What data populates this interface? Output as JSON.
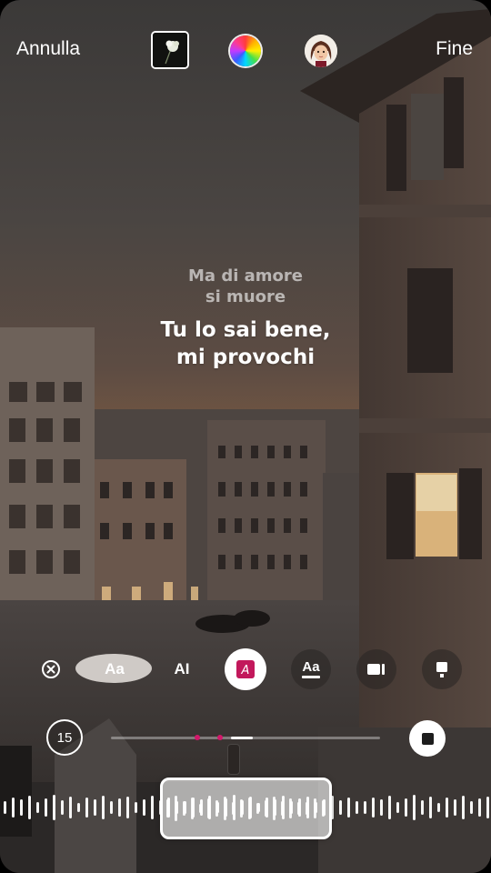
{
  "header": {
    "cancel_label": "Annulla",
    "done_label": "Fine"
  },
  "lyrics": {
    "previous_lines": [
      "Ma di amore",
      "si muore"
    ],
    "current_lines": [
      "Tu lo sai bene,",
      "mi provochi"
    ]
  },
  "toolbar": {
    "tools": [
      {
        "name": "close",
        "glyph": "⊗"
      },
      {
        "name": "font-size",
        "glyph": "Aa"
      },
      {
        "name": "text-animation",
        "glyph": "AI"
      },
      {
        "name": "highlight",
        "glyph": "A",
        "selected": true
      },
      {
        "name": "text-style",
        "glyph": "Aa"
      },
      {
        "name": "video",
        "glyph": ""
      },
      {
        "name": "card",
        "glyph": ""
      }
    ]
  },
  "player": {
    "duration_label": "15",
    "progress": 0.5
  },
  "colors": {
    "accent_highlight": "#c2185b",
    "progress_marker": "#d2186a",
    "text": "#ffffff"
  }
}
